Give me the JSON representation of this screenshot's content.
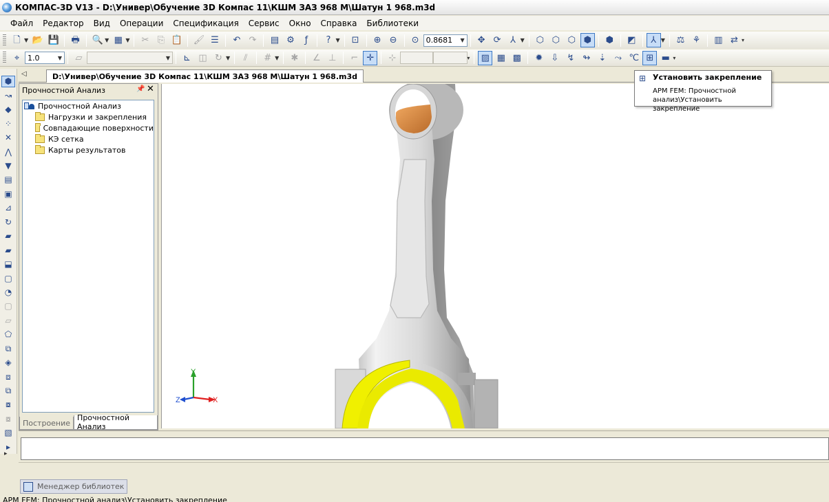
{
  "window": {
    "title": "КОМПАС-3D V13 - D:\\Унивеp\\Обучение 3D Компас 11\\КШМ ЗАЗ 968 М\\Шатун 1 968.m3d"
  },
  "menu": [
    "Файл",
    "Редактор",
    "Вид",
    "Операции",
    "Спецификация",
    "Сервис",
    "Окно",
    "Справка",
    "Библиотеки"
  ],
  "toolbar1": {
    "zoom_value": "0.8681",
    "icons": [
      "new-document-icon",
      "open-icon",
      "save-icon",
      "print-icon",
      "print-preview-icon",
      "properties-icon",
      "cut-icon",
      "copy-icon",
      "paste-icon",
      "format-brush-icon",
      "spec-icon",
      "undo-icon",
      "redo-icon",
      "manager-icon",
      "library-icon",
      "function-icon",
      "help-icon",
      "zoom-window-icon",
      "zoom-in-icon",
      "zoom-out-icon",
      "zoom-scale-icon",
      "pan-icon",
      "rotate-icon",
      "orientation-icon",
      "wireframe-icon",
      "hidden-lines-icon",
      "thin-lines-icon",
      "shaded-icon",
      "shaded-edges-icon",
      "perspective-icon",
      "fem-mode-icon",
      "measure-icon",
      "mass-icon",
      "tree-icon",
      "refresh-icon"
    ]
  },
  "toolbar2": {
    "step_value": "1.0",
    "style_value": "",
    "coord_x": "",
    "coord_y": ""
  },
  "document_tab": {
    "label": "D:\\Унивеp\\Обучение 3D Компас 11\\КШМ ЗАЗ 968 М\\Шатун 1 968.m3d"
  },
  "panel": {
    "title": "Прочностной Анализ",
    "tree": {
      "root": "Прочностной Анализ",
      "children": [
        "Нагрузки и закрепления",
        "Совпадающие поверхности",
        "КЭ сетка",
        "Карты результатов"
      ]
    },
    "tabs": [
      "Построение",
      "Прочностной Анализ"
    ],
    "active_tab": "Прочностной Анализ"
  },
  "viewport": {
    "axes": {
      "x": "X",
      "y": "Y",
      "z": "Z"
    },
    "colors": {
      "part": "#c8c8c8",
      "bushing": "#d98c45",
      "fixture": "#f0f000"
    }
  },
  "tooltip": {
    "title": "Установить закрепление",
    "body": "APM FEM: Прочностной анализ\\Установить закрепление"
  },
  "library_manager": {
    "label": "Менеджер библиотек"
  },
  "status": {
    "text": "APM FEM: Прочностной анализ\\Установить закрепление"
  }
}
